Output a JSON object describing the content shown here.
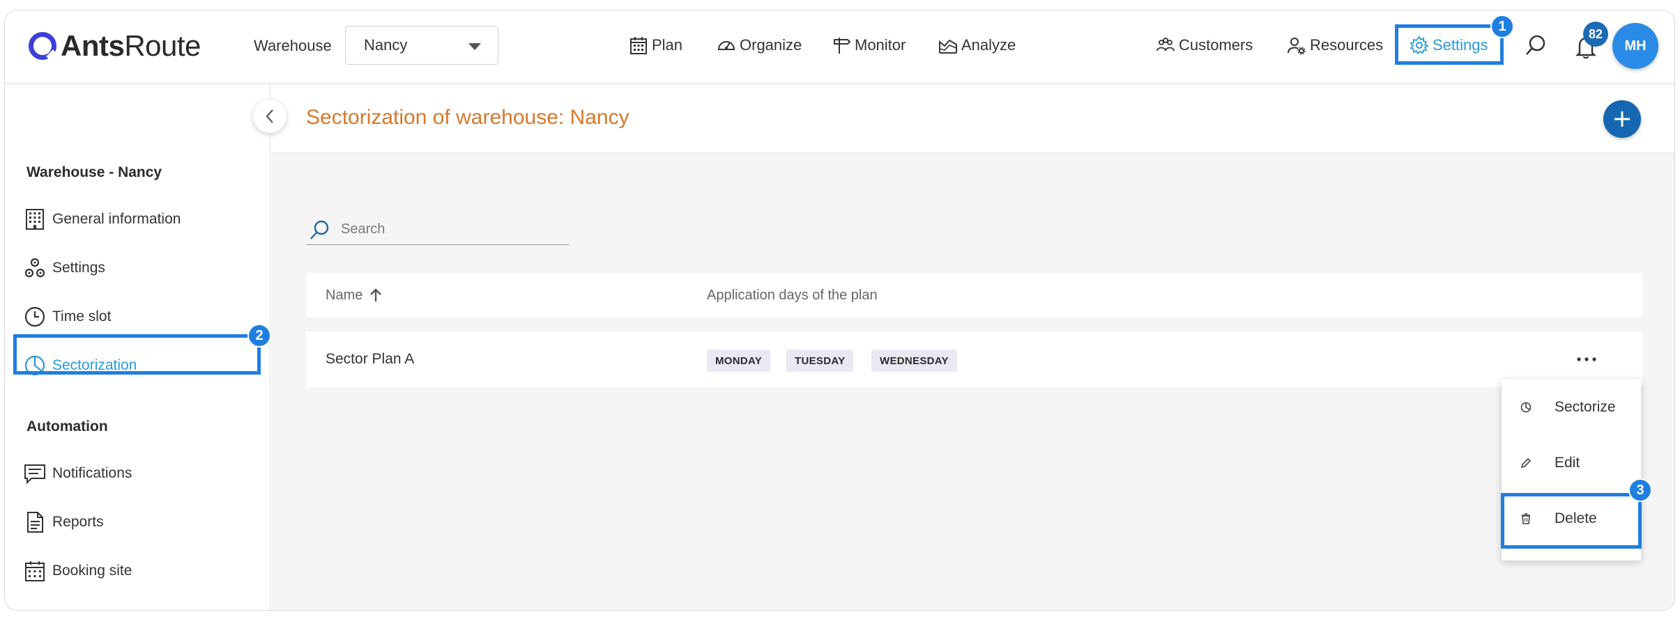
{
  "app": {
    "logo_bold": "Ants",
    "logo_rest": "Route"
  },
  "topbar": {
    "warehouse_label": "Warehouse",
    "warehouse_selected": "Nancy",
    "nav": [
      {
        "label": "Plan",
        "icon": "calendar-icon"
      },
      {
        "label": "Organize",
        "icon": "speedometer-icon"
      },
      {
        "label": "Monitor",
        "icon": "signpost-icon"
      },
      {
        "label": "Analyze",
        "icon": "area-chart-icon"
      }
    ],
    "right": [
      {
        "label": "Customers",
        "icon": "people-icon"
      },
      {
        "label": "Resources",
        "icon": "user-gear-icon"
      },
      {
        "label": "Settings",
        "icon": "gear-icon"
      }
    ],
    "notification_count": "82",
    "avatar_initials": "MH"
  },
  "annotations": {
    "step1": "1",
    "step2": "2",
    "step3": "3"
  },
  "sidebar": {
    "section1_title": "Warehouse - Nancy",
    "items": [
      {
        "label": "General information",
        "icon": "building-icon"
      },
      {
        "label": "Settings",
        "icon": "settings-cogs-icon"
      },
      {
        "label": "Time slot",
        "icon": "clock-icon"
      },
      {
        "label": "Sectorization",
        "icon": "pie-icon"
      }
    ],
    "section2_title": "Automation",
    "automation_items": [
      {
        "label": "Notifications",
        "icon": "message-icon"
      },
      {
        "label": "Reports",
        "icon": "document-icon"
      },
      {
        "label": "Booking site",
        "icon": "calendar-icon"
      }
    ]
  },
  "main": {
    "title": "Sectorization of warehouse: Nancy",
    "search_placeholder": "Search",
    "columns": {
      "name": "Name",
      "days": "Application days of the plan"
    },
    "rows": [
      {
        "name": "Sector Plan A",
        "days": [
          "MONDAY",
          "TUESDAY",
          "WEDNESDAY"
        ]
      }
    ],
    "row_menu": {
      "sectorize": "Sectorize",
      "edit": "Edit",
      "delete": "Delete"
    }
  },
  "colors": {
    "accent": "#1f7fe0",
    "title": "#d7782b",
    "active": "#2a9ad6",
    "primary_button": "#1467b0"
  }
}
